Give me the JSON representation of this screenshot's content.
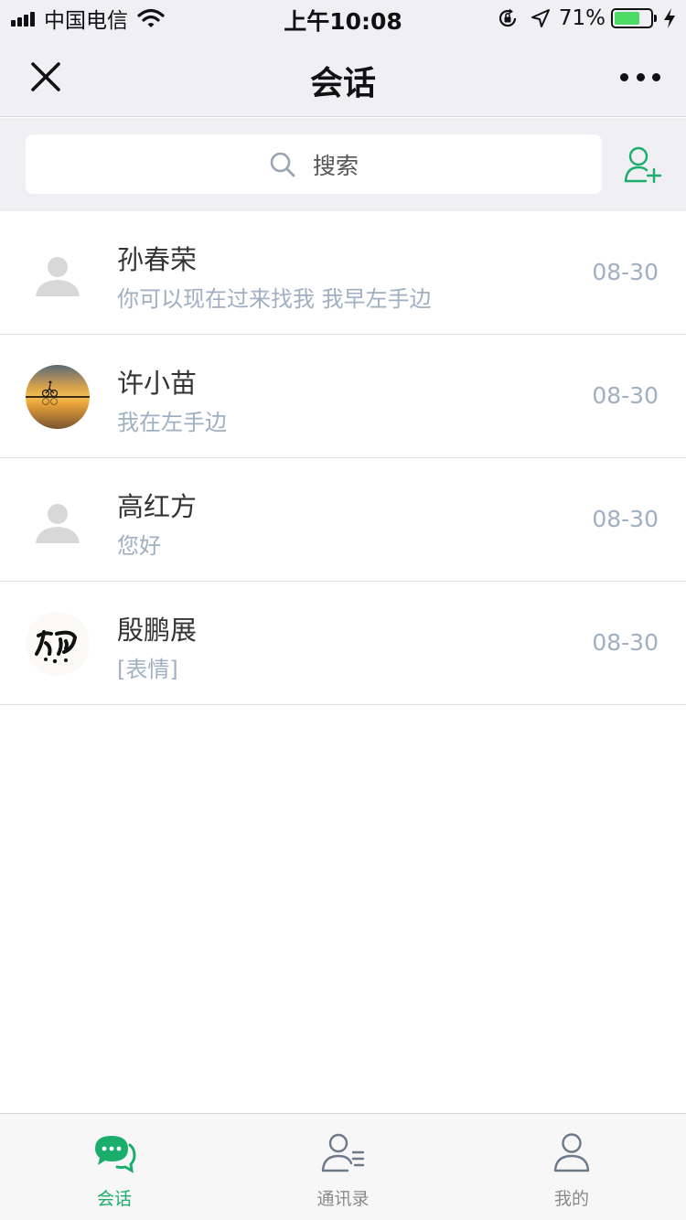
{
  "status_bar": {
    "carrier": "中国电信",
    "time": "上午10:08",
    "battery_percent": "71%",
    "battery_level": 0.71,
    "icons": [
      "signal-icon",
      "wifi-icon",
      "orientation-lock-icon",
      "location-icon",
      "battery-icon",
      "charging-icon"
    ]
  },
  "nav": {
    "title": "会话",
    "close_icon": "close-icon",
    "more_icon": "more-icon"
  },
  "search": {
    "placeholder": "搜索",
    "icon": "search-icon",
    "add_friend_icon": "add-friend-icon"
  },
  "conversations": [
    {
      "name": "孙春荣",
      "message": "你可以现在过来找我 我早左手边",
      "time": "08-30",
      "avatar": "default-avatar"
    },
    {
      "name": "许小苗",
      "message": "我在左手边",
      "time": "08-30",
      "avatar": "sunset-cyclist-photo"
    },
    {
      "name": "高红方",
      "message": "您好",
      "time": "08-30",
      "avatar": "default-avatar"
    },
    {
      "name": "殷鹏展",
      "message": "[表情]",
      "time": "08-30",
      "avatar": "calligraphy-avatar"
    }
  ],
  "tabs": [
    {
      "label": "会话",
      "icon": "chat-icon",
      "active": true
    },
    {
      "label": "通讯录",
      "icon": "contacts-icon",
      "active": false
    },
    {
      "label": "我的",
      "icon": "profile-icon",
      "active": false
    }
  ],
  "colors": {
    "accent": "#1aad6b",
    "header_bg": "#efeff4",
    "muted_text": "#9fb0c2"
  }
}
